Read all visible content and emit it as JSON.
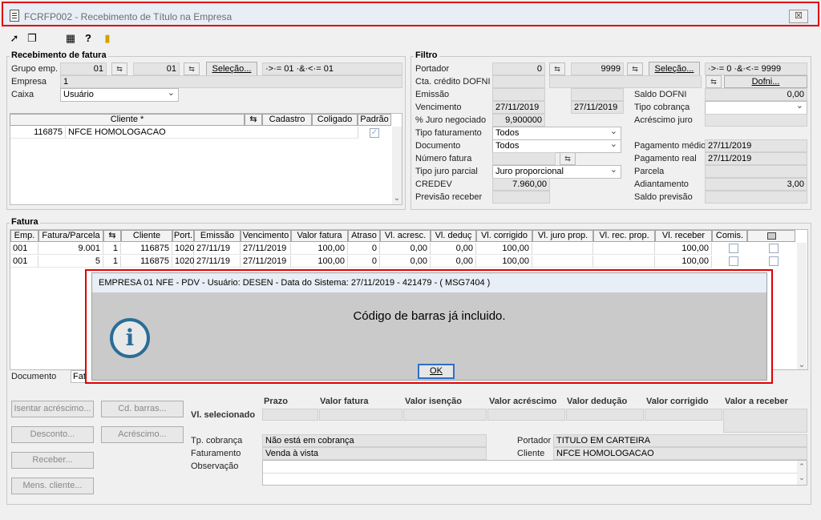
{
  "window": {
    "title": "FCRFP002 - Recebimento de Título na Empresa",
    "close": "☒"
  },
  "receb": {
    "title": "Recebimento de fatura",
    "grupo_label": "Grupo emp.",
    "grupo_from": "01",
    "grupo_to": "01",
    "selecao": "Seleção...",
    "grupo_expr": "·>·= 01 ·&·<·= 01",
    "empresa_label": "Empresa",
    "empresa": "1",
    "caixa_label": "Caixa",
    "caixa": "Usuário",
    "cols": [
      "Cliente *",
      "Cadastro",
      "Coligado",
      "Padrão"
    ],
    "rows": [
      {
        "codigo": "116875",
        "nome": "NFCE HOMOLOGACAO"
      }
    ]
  },
  "filtro": {
    "title": "Filtro",
    "portador_label": "Portador",
    "portador_from": "0",
    "portador_to": "9999",
    "selecao": "Seleção...",
    "portador_expr": "·>·= 0 ·&·<·= 9999",
    "cta_label": "Cta. crédito DOFNI",
    "dofni_btn": "Dofni...",
    "emissao_label": "Emissão",
    "saldo_dofni_label": "Saldo DOFNI",
    "saldo_dofni": "0,00",
    "venc_label": "Vencimento",
    "venc_from": "27/11/2019",
    "venc_to": "27/11/2019",
    "tipo_cobr_label": "Tipo cobrança",
    "juro_neg_label": "% Juro negociado",
    "juro_neg": "9,900000",
    "acresc_juro_label": "Acréscimo juro",
    "tipo_fat_label": "Tipo faturamento",
    "tipo_fat": "Todos",
    "documento_label": "Documento",
    "documento": "Todos",
    "pag_medio_label": "Pagamento médio",
    "pag_medio": "27/11/2019",
    "num_fat_label": "Número fatura",
    "pag_real_label": "Pagamento real",
    "pag_real": "27/11/2019",
    "tipo_juro_label": "Tipo juro parcial",
    "tipo_juro": "Juro proporcional",
    "parcela_label": "Parcela",
    "credev_label": "CREDEV",
    "credev": "7.960,00",
    "adiant_label": "Adiantamento",
    "adiant": "3,00",
    "prev_label": "Previsão receber",
    "saldo_prev_label": "Saldo previsão"
  },
  "fatura": {
    "title": "Fatura",
    "cols": [
      "Emp.",
      "Fatura/Parcela",
      "",
      "Cliente",
      "Port.",
      "Emissão",
      "Vencimento",
      "Valor fatura",
      "Atraso",
      "Vl. acresc.",
      "Vl. deduç",
      "Vl. corrigido",
      "Vl. juro prop.",
      "Vl. rec. prop.",
      "Vl. receber",
      "Comis.",
      ""
    ],
    "rows": [
      {
        "emp": "001",
        "fatura": "9.001",
        "parcela": "1",
        "cliente": "116875",
        "port": "1020",
        "emissao": "27/11/19",
        "venc": "27/11/2019",
        "valor": "100,00",
        "atraso": "0",
        "acresc": "0,00",
        "deduc": "0,00",
        "corrigido": "100,00",
        "juro": "",
        "rec": "",
        "receber": "100,00"
      },
      {
        "emp": "001",
        "fatura": "5",
        "parcela": "1",
        "cliente": "116875",
        "port": "1020",
        "emissao": "27/11/19",
        "venc": "27/11/2019",
        "valor": "100,00",
        "atraso": "0",
        "acresc": "0,00",
        "deduc": "0,00",
        "corrigido": "100,00",
        "juro": "",
        "rec": "",
        "receber": "100,00"
      }
    ],
    "documento_label": "Documento",
    "documento_val": "Fat"
  },
  "buttons": {
    "isentar": "Isentar acréscimo...",
    "cd_barras": "Cd. barras...",
    "desconto": "Desconto...",
    "acrescimo": "Acréscimo...",
    "receber": "Receber...",
    "mens": "Mens. cliente..."
  },
  "summary": {
    "cols": [
      "Prazo",
      "Valor fatura",
      "Valor isenção",
      "Valor acréscimo",
      "Valor dedução",
      "Valor corrigido",
      "Valor a receber"
    ],
    "sel_label": "Vl. selecionado",
    "tp_cobr_label": "Tp. cobrança",
    "tp_cobr": "Não está em cobrança",
    "fat_label": "Faturamento",
    "fat": "Venda à vista",
    "obs_label": "Observação",
    "portador_label": "Portador",
    "portador": "TITULO EM CARTEIRA",
    "cliente_label": "Cliente",
    "cliente": "NFCE HOMOLOGACAO"
  },
  "dialog": {
    "title": "EMPRESA 01 NFE - PDV - Usuário: DESEN - Data do Sistema: 27/11/2019 - 421479 - ( MSG7404 )",
    "message": "Código de barras já incluido.",
    "ok": "OK",
    "icon": "i"
  }
}
